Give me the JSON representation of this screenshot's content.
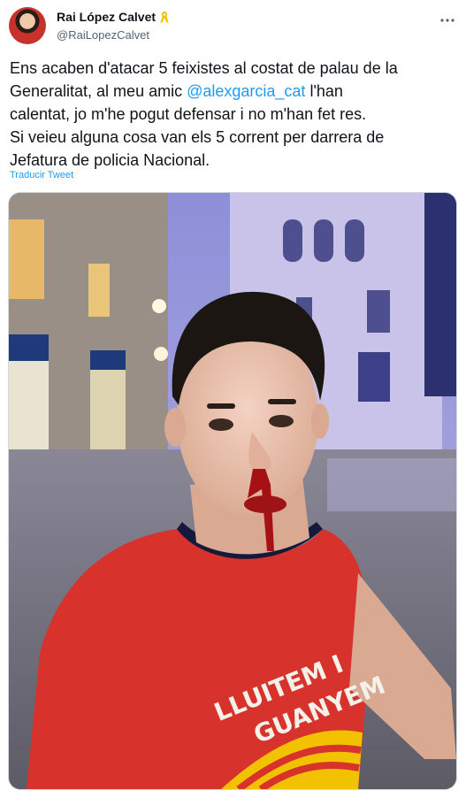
{
  "author": {
    "name": "Rai López Calvet",
    "handle": "@RaiLopezCalvet",
    "badge_icon": "yellow-ribbon-icon"
  },
  "tweet": {
    "lines": [
      {
        "before": "Ens acaben d'atacar 5 feixistes al costat de palau de la",
        "mention": "",
        "after": ""
      },
      {
        "before": "Generalitat, al meu amic ",
        "mention": "@alexgarcia_cat",
        "after": " l'han"
      },
      {
        "before": "calentat, jo m'he pogut defensar i no m'han fet res.",
        "mention": "",
        "after": ""
      },
      {
        "before": "Si veieu alguna cosa van els 5 corrent per darrera de",
        "mention": "",
        "after": ""
      },
      {
        "before": "Jefatura de policia Nacional.",
        "mention": "",
        "after": ""
      }
    ],
    "translate_link": "Traducir Tweet"
  },
  "photo": {
    "shirt_text_line1": "LLUITEM I",
    "shirt_text_line2": "GUANYEM"
  },
  "colors": {
    "link": "#1d9bf0",
    "secondary_text": "#536471",
    "shirt_red": "#d7322b"
  }
}
